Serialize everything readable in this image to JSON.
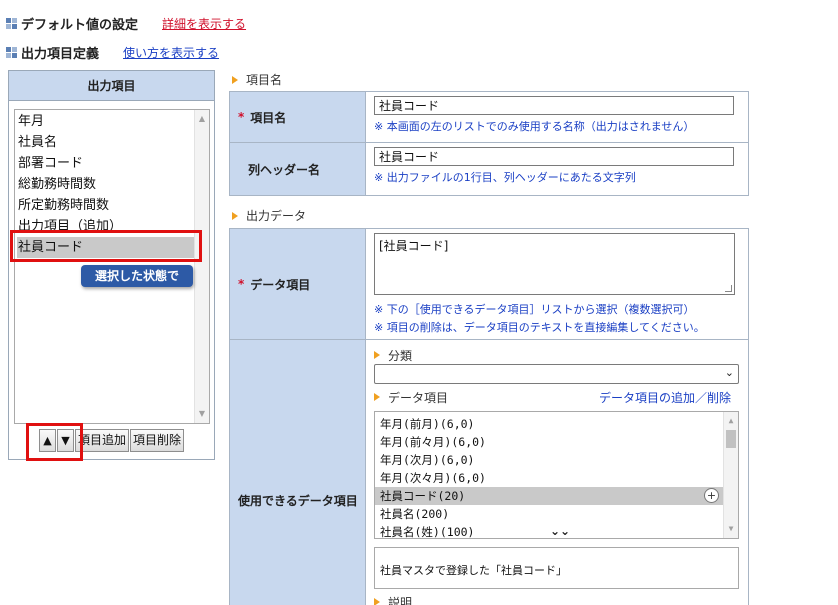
{
  "header": {
    "default_settings_title": "デフォルト値の設定",
    "default_settings_link": "詳細を表示する",
    "output_def_title": "出力項目定義",
    "output_def_link": "使い方を表示する"
  },
  "left_panel": {
    "header": "出力項目",
    "items": [
      {
        "label": "年月"
      },
      {
        "label": "社員名"
      },
      {
        "label": "部署コード"
      },
      {
        "label": "総勤務時間数"
      },
      {
        "label": "所定勤務時間数"
      },
      {
        "label": "出力項目（追加）"
      },
      {
        "label": "社員コード"
      }
    ],
    "selected_index": 6,
    "tooltip": "選択した状態で",
    "up_arrow": "▲",
    "down_arrow": "▼",
    "add_button": "項目追加",
    "delete_button": "項目削除"
  },
  "item_name_section": {
    "heading": "項目名",
    "name_label": "項目名",
    "required_mark": "*",
    "name_value": "社員コード",
    "name_note": "※ 本画面の左のリストでのみ使用する名称（出力はされません）",
    "column_header_label": "列ヘッダー名",
    "column_header_value": "社員コード",
    "column_header_note": "※ 出力ファイルの1行目、列ヘッダーにあたる文字列"
  },
  "output_data_section": {
    "heading": "出力データ",
    "data_item_label": "データ項目",
    "required_mark": "*",
    "data_item_value": "[社員コード]",
    "data_item_note1": "※ 下の［使用できるデータ項目］リストから選択（複数選択可）",
    "data_item_note2": "※ 項目の削除は、データ項目のテキストを直接編集してください。",
    "available_label": "使用できるデータ項目",
    "category_heading": "分類",
    "category_value": "",
    "data_items_heading": "データ項目",
    "add_remove_link": "データ項目の追加／削除",
    "data_items": [
      {
        "label": "年月(前月)(6,0)"
      },
      {
        "label": "年月(前々月)(6,0)"
      },
      {
        "label": "年月(次月)(6,0)"
      },
      {
        "label": "年月(次々月)(6,0)"
      },
      {
        "label": "社員コード(20)"
      },
      {
        "label": "社員名(200)"
      },
      {
        "label": "社員名(姓)(100)"
      }
    ],
    "selected_data_index": 4,
    "description": "社員マスタで登録した「社員コード」",
    "next_heading": "説明"
  },
  "colors": {
    "header_bg": "#c8d8ee",
    "highlight": "#e01010",
    "tooltip_bg": "#2d5aa6",
    "link_blue": "#1a3fc4",
    "link_red": "#d0102b",
    "note_blue": "#1a3fc4",
    "arrow_orange": "#f0a020"
  }
}
